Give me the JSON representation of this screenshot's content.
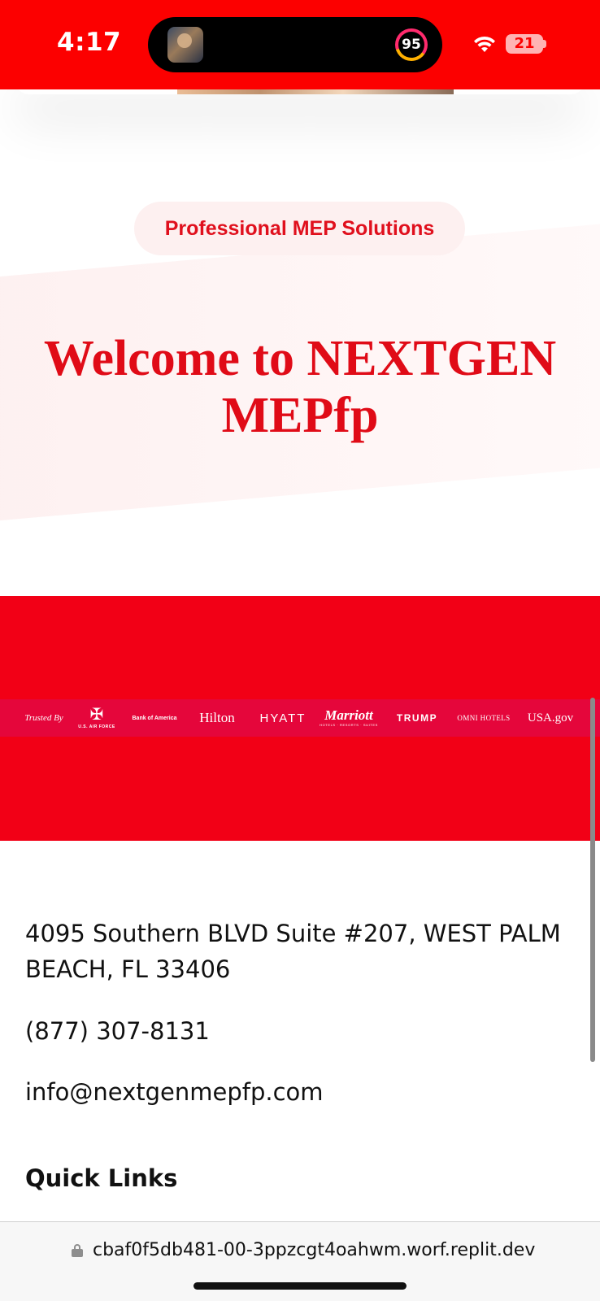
{
  "status_bar": {
    "time": "4:17",
    "activity_ring_value": "95",
    "battery_level": "21",
    "icons": [
      "now-playing-thumbnail-icon",
      "activity-ring-icon",
      "wifi-icon",
      "battery-icon"
    ],
    "colors": {
      "background": "#fc0000"
    }
  },
  "hero": {
    "badge": "Professional MEP Solutions",
    "title": "Welcome to NEXTGEN MEPfp",
    "colors": {
      "accent": "#e00b17",
      "badge_bg": "#fdf0f0"
    }
  },
  "trusted_band": {
    "label": "Trusted By",
    "logos": [
      {
        "name": "U.S. Air Force",
        "text": "U.S. AIR FORCE"
      },
      {
        "name": "Bank of America",
        "text": "Bank of America"
      },
      {
        "name": "Hilton",
        "text": "Hilton"
      },
      {
        "name": "Hyatt",
        "text": "HYATT"
      },
      {
        "name": "Marriott",
        "text": "Marriott",
        "subtext": "HOTELS · RESORTS · SUITES"
      },
      {
        "name": "Trump",
        "text": "TRUMP"
      },
      {
        "name": "Omni Hotels",
        "text": "OMNI HOTELS"
      },
      {
        "name": "USA.gov",
        "text": "USA.gov"
      }
    ],
    "colors": {
      "band": "#f20016",
      "strip": "#e5063b"
    }
  },
  "contact": {
    "address": "4095 Southern BLVD Suite #207, WEST PALM BEACH, FL 33406",
    "phone": "(877) 307-8131",
    "email": "info@nextgenmepfp.com"
  },
  "footer": {
    "quick_links_heading": "Quick Links"
  },
  "browser": {
    "url": "cbaf0f5db481-00-3ppzcgt4oahwm.worf.replit.dev"
  }
}
